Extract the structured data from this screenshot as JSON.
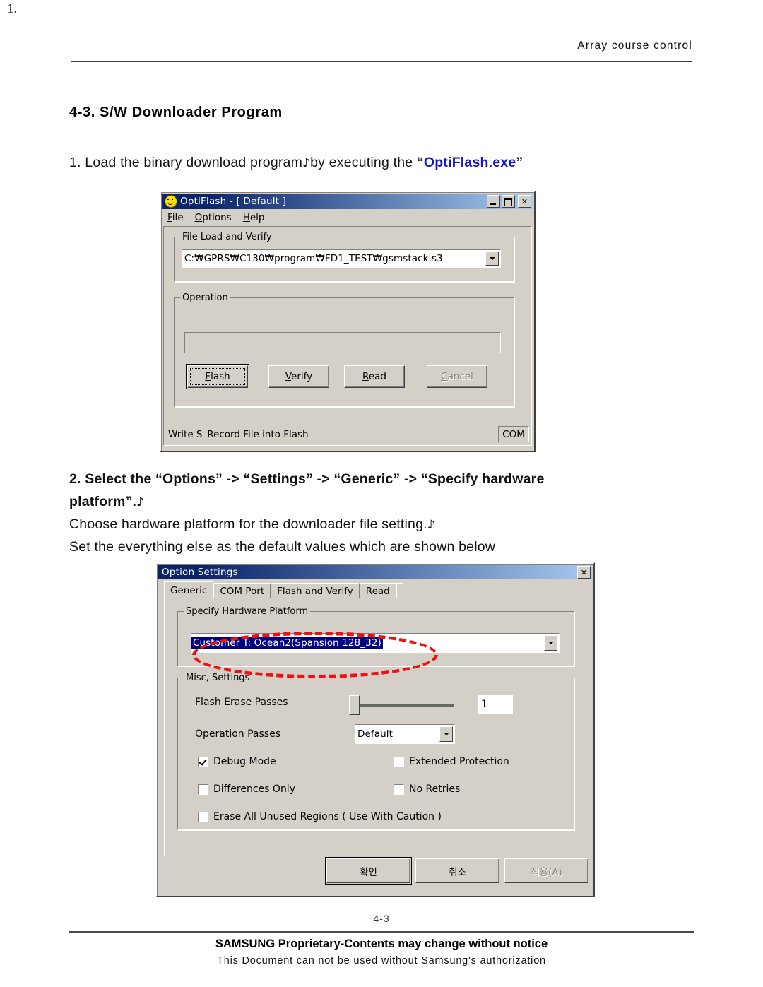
{
  "page": {
    "corner_mark": "1.",
    "header_right": "Array course control",
    "page_number": "4-3",
    "footer_line1": "SAMSUNG Proprietary-Contents may change without notice",
    "footer_line2": "This Document can not be used without Samsung's authorization",
    "section_title": "4-3. S/W Downloader Program"
  },
  "steps": {
    "step1_prefix": "1. Load the binary download program",
    "step1_mark": "♪",
    "step1_mid": "by executing the ",
    "step1_quote_open": "“",
    "step1_highlight": "OptiFlash.exe",
    "step1_quote_close": "”",
    "step2_line1": "2. Select the “Options” -> “Settings” -> “Generic” -> “Specify hardware",
    "step2_line2": "platform”.",
    "step2_line2_mark": "♪",
    "step3": "Choose hardware platform for the downloader file setting.",
    "step3_mark": "♪",
    "step4": "Set the everything else as the default values which are shown below",
    "highlight_color": "#1414d2"
  },
  "optiflash_window": {
    "title": "OptiFlash - [ Default ]",
    "icon": "smiley-face-icon",
    "titlebar_buttons": [
      "minimize",
      "maximize",
      "close"
    ],
    "menu": [
      "File",
      "Options",
      "Help"
    ],
    "file_group": {
      "label": "File Load and Verify",
      "path_value": "C:₩GPRS₩C130₩program₩FD1_TEST₩gsmstack.s3"
    },
    "operation_group": {
      "label": "Operation",
      "progress_value": "",
      "buttons": [
        {
          "label": "Flash",
          "accel": "F",
          "state": "default-focused"
        },
        {
          "label": "Verify",
          "accel": "V",
          "state": "normal"
        },
        {
          "label": "Read",
          "accel": "R",
          "state": "normal"
        },
        {
          "label": "Cancel",
          "accel": "C",
          "state": "disabled"
        }
      ]
    },
    "status_left": "Write S_Record File into Flash",
    "status_right": "COM"
  },
  "option_settings_dialog": {
    "title": "Option Settings",
    "close_label": "✕",
    "tabs": [
      {
        "label": "Generic",
        "active": true
      },
      {
        "label": "COM Port",
        "active": false
      },
      {
        "label": "Flash and Verify",
        "active": false
      },
      {
        "label": "Read",
        "active": false
      }
    ],
    "hardware_group": {
      "label": "Specify Hardware Platform",
      "selected_value": "Customer T: Ocean2(Spansion 128_32)",
      "annotation": "red-dashed-ellipse",
      "annotation_color": "#ee1111"
    },
    "misc_group": {
      "label": "Misc, Settings",
      "flash_erase_passes_label": "Flash Erase Passes",
      "flash_erase_passes_value": "1",
      "operation_passes_label": "Operation Passes",
      "operation_passes_value": "Default",
      "checkboxes": [
        {
          "label": "Debug Mode",
          "checked": true
        },
        {
          "label": "Extended Protection",
          "checked": false
        },
        {
          "label": "Differences Only",
          "checked": false
        },
        {
          "label": "No Retries",
          "checked": false
        },
        {
          "label": "Erase All Unused Regions ( Use With Caution )",
          "checked": false
        }
      ]
    },
    "buttons": [
      {
        "label": "확인",
        "state": "default"
      },
      {
        "label": "취소",
        "state": "normal"
      },
      {
        "label": "적용(A)",
        "state": "disabled"
      }
    ]
  }
}
